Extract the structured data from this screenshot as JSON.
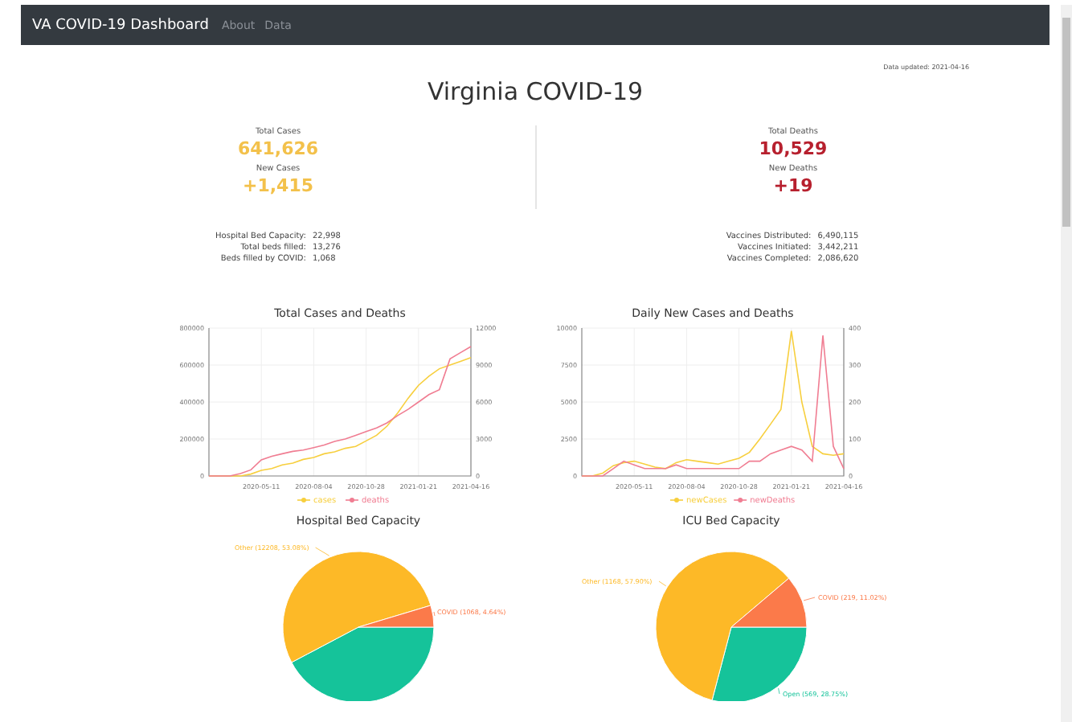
{
  "navbar": {
    "brand": "VA COVID-19 Dashboard",
    "links": [
      "About",
      "Data"
    ]
  },
  "updated": "Data updated: 2021-04-16",
  "title": "Virginia COVID-19",
  "summary": [
    {
      "kind": "cases",
      "stats": [
        {
          "label": "Total Cases",
          "value": "641,626"
        },
        {
          "label": "New Cases",
          "value": "+1,415"
        }
      ],
      "details": [
        {
          "label": "Hospital Bed Capacity:",
          "value": "22,998"
        },
        {
          "label": "Total beds filled:",
          "value": "13,276"
        },
        {
          "label": "Beds filled by COVID:",
          "value": "1,068"
        }
      ]
    },
    {
      "kind": "deaths",
      "stats": [
        {
          "label": "Total Deaths",
          "value": "10,529"
        },
        {
          "label": "New Deaths",
          "value": "+19"
        }
      ],
      "details": [
        {
          "label": "Vaccines Distributed:",
          "value": "6,490,115"
        },
        {
          "label": "Vaccines Initiated:",
          "value": "3,442,211"
        },
        {
          "label": "Vaccines Completed:",
          "value": "2,086,620"
        }
      ]
    }
  ],
  "line_charts": [
    {
      "chart_data": {
        "type": "line",
        "title": "Total Cases and Deaths",
        "grid": true,
        "legend": "bottom",
        "categories": [
          null,
          null,
          null,
          null,
          null,
          "2020-05-11",
          null,
          null,
          null,
          null,
          "2020-08-04",
          null,
          null,
          null,
          null,
          "2020-10-28",
          null,
          null,
          null,
          null,
          "2021-01-21",
          null,
          null,
          null,
          null,
          "2021-04-16"
        ],
        "ylim": [
          0,
          800000
        ],
        "yticks": [
          0,
          200000,
          400000,
          600000,
          800000
        ],
        "y2lim": [
          0,
          12000
        ],
        "y2ticks": [
          0,
          3000,
          6000,
          9000,
          12000
        ],
        "series": [
          {
            "name": "cases",
            "color": "#f7cf3e",
            "values": [
              0,
              0,
              0,
              0,
              10000,
              30000,
              40000,
              60000,
              70000,
              90000,
              100000,
              120000,
              130000,
              150000,
              160000,
              190000,
              220000,
              270000,
              340000,
              420000,
              490000,
              540000,
              580000,
              600000,
              620000,
              640000
            ]
          },
          {
            "name": "deaths",
            "color": "#f07d92",
            "axis": "y2",
            "values": [
              0,
              0,
              0,
              200,
              500,
              1300,
              1600,
              1800,
              2000,
              2100,
              2300,
              2500,
              2800,
              3000,
              3300,
              3600,
              3900,
              4300,
              4900,
              5400,
              6000,
              6600,
              7000,
              9500,
              10000,
              10500
            ]
          }
        ]
      }
    },
    {
      "chart_data": {
        "type": "line",
        "title": "Daily New Cases and Deaths",
        "grid": true,
        "legend": "bottom",
        "categories": [
          null,
          null,
          null,
          null,
          null,
          "2020-05-11",
          null,
          null,
          null,
          null,
          "2020-08-04",
          null,
          null,
          null,
          null,
          "2020-10-28",
          null,
          null,
          null,
          null,
          "2021-01-21",
          null,
          null,
          null,
          null,
          "2021-04-16"
        ],
        "ylim": [
          0,
          10000
        ],
        "yticks": [
          0,
          2500,
          5000,
          7500,
          10000
        ],
        "y2lim": [
          0,
          400
        ],
        "y2ticks": [
          0,
          100,
          200,
          300,
          400
        ],
        "series": [
          {
            "name": "newCases",
            "color": "#f7cf3e",
            "values": [
              0,
              0,
              200,
              700,
              900,
              1000,
              800,
              600,
              500,
              900,
              1100,
              1000,
              900,
              800,
              1000,
              1200,
              1600,
              2500,
              3500,
              4500,
              9800,
              5000,
              2000,
              1500,
              1400,
              1500
            ]
          },
          {
            "name": "newDeaths",
            "color": "#f07d92",
            "axis": "y2",
            "values": [
              0,
              0,
              0,
              20,
              40,
              30,
              20,
              20,
              20,
              30,
              20,
              20,
              20,
              20,
              20,
              20,
              40,
              40,
              60,
              70,
              80,
              70,
              40,
              380,
              80,
              20
            ]
          }
        ]
      }
    }
  ],
  "pie_charts": [
    {
      "chart_data": {
        "type": "pie",
        "title": "Hospital Bed Capacity",
        "categories": [
          null,
          "Other",
          "COVID"
        ],
        "values": [
          9722,
          12208,
          1068
        ],
        "colors": [
          "#15c39a",
          "#fdb927",
          "#fb7a4a"
        ],
        "value_labels": [
          null,
          "(12208, 53.08%)",
          "(1068, 4.64%)"
        ]
      }
    },
    {
      "chart_data": {
        "type": "pie",
        "title": "ICU Bed Capacity",
        "categories": [
          "Open",
          "Other",
          "COVID"
        ],
        "values": [
          569,
          1168,
          219
        ],
        "colors": [
          "#15c39a",
          "#fdb927",
          "#fb7a4a"
        ],
        "value_labels": [
          "(569, 28.75%)",
          "(1168, 57.90%)",
          "(219, 11.02%)"
        ]
      }
    }
  ]
}
